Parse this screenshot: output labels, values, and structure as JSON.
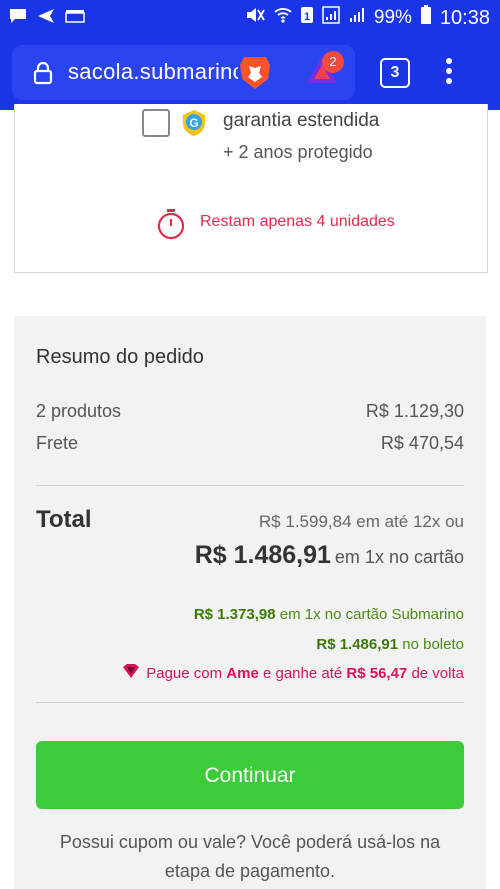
{
  "statusbar": {
    "battery": "99%",
    "time": "10:38",
    "sim": "1"
  },
  "browser": {
    "url": "sacola.submarino",
    "tab_count": "3",
    "rewards_badge": "2"
  },
  "product": {
    "warranty_title": "garantia estendida",
    "warranty_subtitle": "+ 2 anos protegido",
    "stock_message": "Restam apenas 4 unidades"
  },
  "summary": {
    "title": "Resumo do pedido",
    "rows": [
      {
        "label": "2 produtos",
        "value": "R$ 1.129,30"
      },
      {
        "label": "Frete",
        "value": "R$ 470,54"
      }
    ],
    "total_label": "Total",
    "total_installments": "R$ 1.599,84 em até 12x ou",
    "total_value": "R$ 1.486,91",
    "total_value_suffix": "em 1x no cartão",
    "card_price": "R$ 1.373,98",
    "card_price_suffix": "em 1x no cartão Submarino",
    "boleto_price": "R$ 1.486,91",
    "boleto_suffix": "no boleto",
    "ame_prefix": "Pague com",
    "ame_brand": "Ame",
    "ame_middle": "e ganhe até",
    "ame_amount": "R$ 56,47",
    "ame_suffix": "de volta"
  },
  "actions": {
    "continue_label": "Continuar",
    "coupon_note": "Possui cupom ou vale? Você poderá usá-los na etapa de pagamento."
  },
  "colors": {
    "browser_bar": "#1a35e6",
    "stock_red": "#e4294b",
    "price_green": "#4b8a14",
    "ame_pink": "#d4135b",
    "continue_green": "#3bcb3b"
  }
}
